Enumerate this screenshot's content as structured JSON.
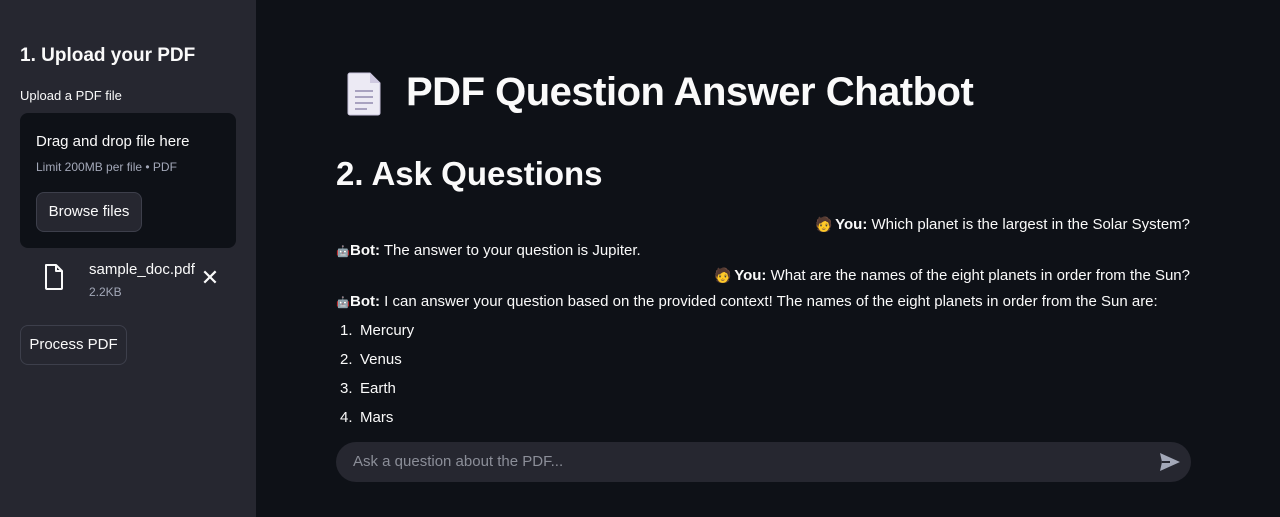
{
  "sidebar": {
    "title": "1. Upload your PDF",
    "upload_label": "Upload a PDF file",
    "dropzone": {
      "title": "Drag and drop file here",
      "limit": "Limit 200MB per file • PDF",
      "browse_label": "Browse files"
    },
    "file": {
      "name": "sample_doc.pdf",
      "size": "2.2KB",
      "close_glyph": "✕"
    },
    "process_label": "Process PDF"
  },
  "main": {
    "title": "PDF Question Answer Chatbot",
    "section_title": "2. Ask Questions",
    "messages": [
      {
        "role": "user",
        "emoji": "🧑",
        "speaker": "You:",
        "text": " Which planet is the largest in the Solar System?"
      },
      {
        "role": "bot",
        "emoji": "🤖",
        "speaker": "Bot:",
        "text": " The answer to your question is Jupiter."
      },
      {
        "role": "user",
        "emoji": "🧑",
        "speaker": "You:",
        "text": " What are the names of the eight planets in order from the Sun?"
      },
      {
        "role": "bot",
        "emoji": "🤖",
        "speaker": "Bot:",
        "text": " I can answer your question based on the provided context! The names of the eight planets in order from the Sun are:"
      }
    ],
    "list": [
      {
        "num": "1.",
        "text": "Mercury"
      },
      {
        "num": "2.",
        "text": "Venus"
      },
      {
        "num": "3.",
        "text": "Earth"
      },
      {
        "num": "4.",
        "text": "Mars"
      }
    ],
    "chat_input": {
      "placeholder": "Ask a question about the PDF..."
    }
  },
  "colors": {
    "background": "#0e1117",
    "sidebar": "#262730",
    "text": "#fafafa",
    "muted": "#a3a8b8"
  },
  "icons": [
    "file-icon",
    "close-icon",
    "page-facing-up-icon",
    "send-icon"
  ]
}
